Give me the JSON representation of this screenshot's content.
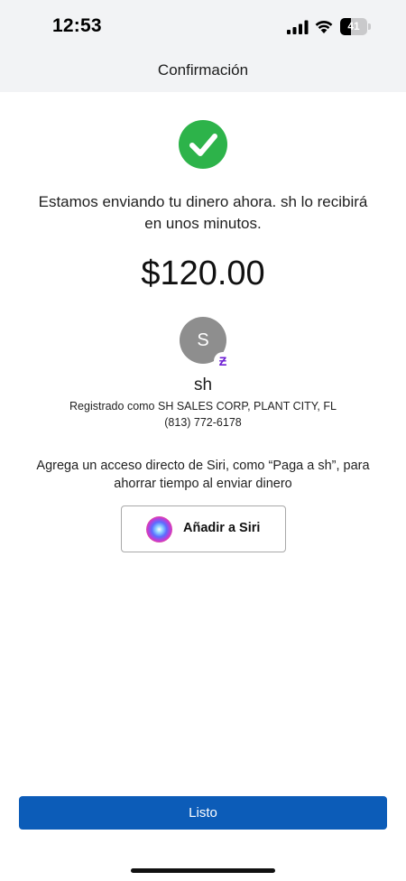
{
  "status_bar": {
    "time": "12:53",
    "battery_level": "41",
    "battery_fraction": 0.41,
    "icons": [
      "signal-icon",
      "wifi-icon",
      "battery-icon"
    ]
  },
  "header": {
    "title": "Confirmación"
  },
  "confirmation": {
    "icon": "check-circle-icon",
    "message": "Estamos enviando tu dinero ahora. sh lo recibirá en unos minutos.",
    "amount": "$120.00"
  },
  "recipient": {
    "initial": "S",
    "badge_icon": "zelle-icon",
    "badge_glyph": "Ƶ",
    "name": "sh",
    "registered_as": "Registrado como SH SALES CORP, PLANT CITY, FL",
    "phone": "(813) 772-6178"
  },
  "siri": {
    "prompt": "Agrega un acceso directo de Siri, como “Paga a sh”, para ahorrar tiempo al enviar dinero",
    "button_label": "Añadir a Siri",
    "icon": "siri-icon"
  },
  "footer": {
    "done_label": "Listo"
  },
  "colors": {
    "header_bg": "#f2f3f5",
    "success_green": "#2db34a",
    "primary_blue": "#0c5cb8",
    "zelle_purple": "#6d1ed4",
    "avatar_gray": "#8e8e8e"
  }
}
